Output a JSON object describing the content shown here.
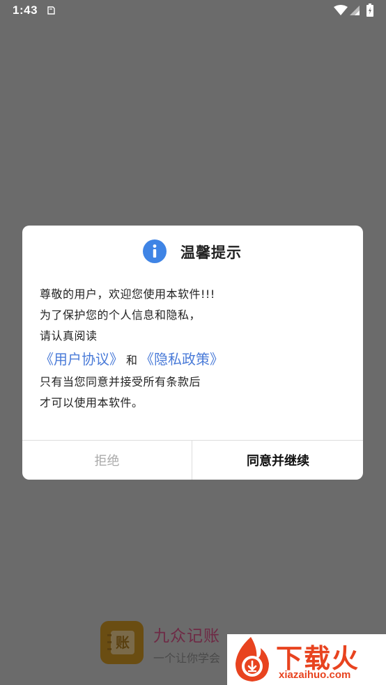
{
  "status_bar": {
    "time": "1:43"
  },
  "dialog": {
    "title": "温馨提示",
    "lines": [
      "尊敬的用户，欢迎您使用本软件!!!",
      "为了保护您的个人信息和隐私，",
      "请认真阅读"
    ],
    "links": {
      "user_agreement": "《用户协议》",
      "connector": "和",
      "privacy_policy": "《隐私政策》"
    },
    "lines_after": [
      "只有当您同意并接受所有条款后",
      "才可以使用本软件。"
    ],
    "decline_label": "拒绝",
    "agree_label": "同意并继续"
  },
  "background_app": {
    "logo_glyph": "账",
    "name": "九众记账",
    "slogan": "一个让你学会"
  },
  "watermark": {
    "text": "下载火",
    "url": "xiazaihuo.com"
  },
  "colors": {
    "overlay": "#6b6b6b",
    "link": "#4a7bd8",
    "info_icon": "#3f84e5",
    "watermark": "#e8431f"
  }
}
